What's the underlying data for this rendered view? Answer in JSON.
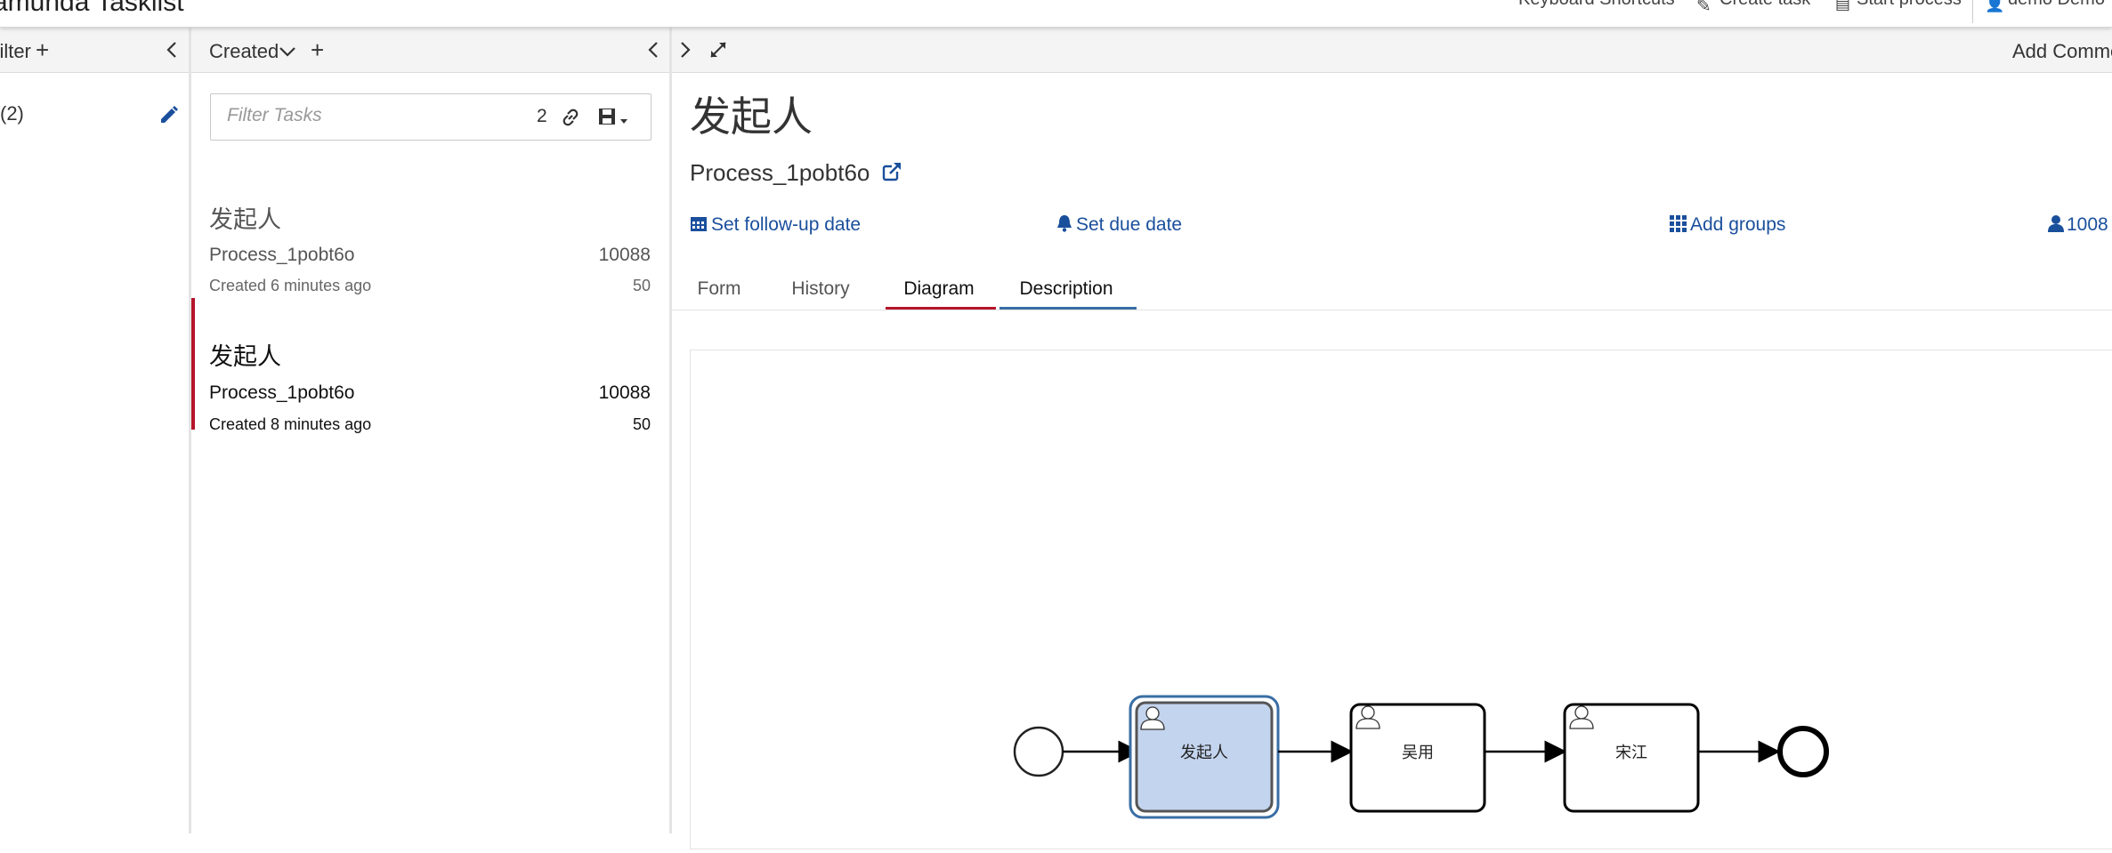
{
  "header": {
    "brand": "amunda Tasklist",
    "links": [
      "Keyboard Shortcuts",
      "Create task",
      "Start process",
      "demo Demo"
    ]
  },
  "filters": {
    "bar_label": "Filter",
    "add_symbol": "+",
    "items": [
      {
        "label": "(2)"
      }
    ]
  },
  "list": {
    "sort_label": "Created",
    "add_symbol": "+",
    "search": {
      "placeholder": "Filter Tasks",
      "count": "2"
    },
    "tasks": [
      {
        "name": "发起人",
        "process": "Process_1pobt6o",
        "priority": "10088",
        "created": "Created 6 minutes ago",
        "sub": "50",
        "selected": false
      },
      {
        "name": "发起人",
        "process": "Process_1pobt6o",
        "priority": "10088",
        "created": "Created 8 minutes ago",
        "sub": "50",
        "selected": true
      }
    ]
  },
  "detail": {
    "toolbar_right": "Add Comme",
    "title": "发起人",
    "process": "Process_1pobt6o",
    "actions": {
      "follow_up": "Set follow-up date",
      "due": "Set due date",
      "groups": "Add groups",
      "assignee": "1008"
    },
    "tabs": [
      "Form",
      "History",
      "Diagram",
      "Description"
    ],
    "active_tab": "Diagram",
    "accent_colors": {
      "active": "#b5152b",
      "hover": "#3a6ea5",
      "link": "#1a4f9c"
    }
  },
  "diagram": {
    "tasks": [
      "发起人",
      "吴用",
      "宋江"
    ],
    "highlighted": "发起人"
  }
}
